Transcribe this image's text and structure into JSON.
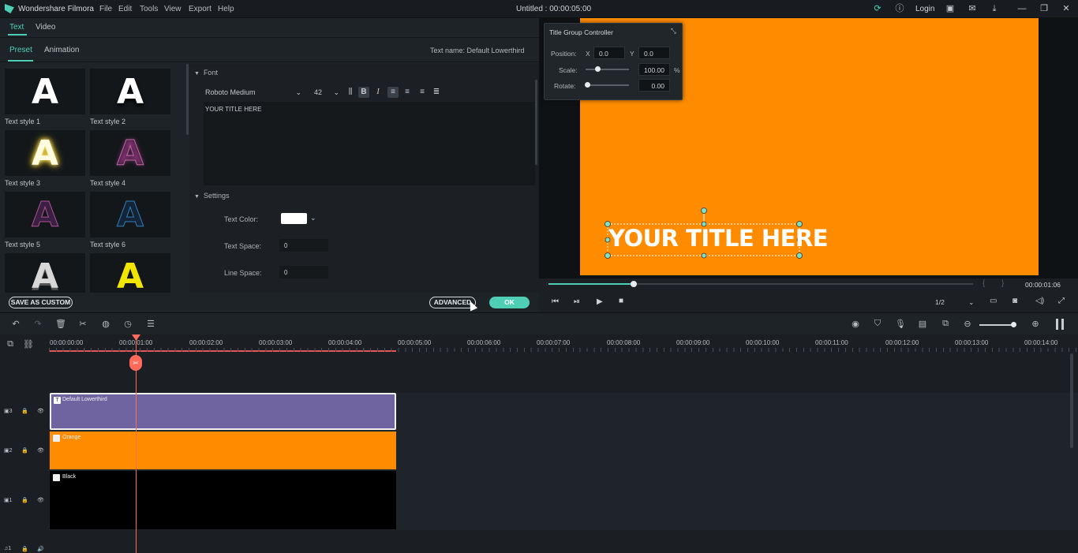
{
  "app": {
    "name": "Wondershare Filmora",
    "doc_title": "Untitled : 00:00:05:00",
    "login": "Login"
  },
  "menu": [
    "File",
    "Edit",
    "Tools",
    "View",
    "Export",
    "Help"
  ],
  "tabs_top": [
    "Text",
    "Video"
  ],
  "tabs_sub": [
    "Preset",
    "Animation"
  ],
  "text_name": "Text name: Default Lowerthird",
  "styles": [
    {
      "label": "Text style 1",
      "glyph": "A"
    },
    {
      "label": "Text style 2",
      "glyph": "A"
    },
    {
      "label": "Text style 3",
      "glyph": "A"
    },
    {
      "label": "Text style 4",
      "glyph": "A"
    },
    {
      "label": "Text style 5",
      "glyph": "A"
    },
    {
      "label": "Text style 6",
      "glyph": "A"
    },
    {
      "label": "",
      "glyph": "A"
    },
    {
      "label": "",
      "glyph": "A"
    }
  ],
  "font": {
    "section": "Font",
    "family": "Roboto Medium",
    "size": "42",
    "text": "YOUR TITLE HERE"
  },
  "settings": {
    "section": "Settings",
    "color_label": "Text Color:",
    "space_label": "Text Space:",
    "space_value": "0",
    "line_label": "Line Space:",
    "line_value": "0",
    "color": "#ffffff"
  },
  "buttons": {
    "save_custom": "SAVE AS CUSTOM",
    "advanced": "ADVANCED",
    "ok": "OK"
  },
  "tgc": {
    "title": "Title Group Controller",
    "position_label": "Position:",
    "x_label": "X",
    "x": "0.0",
    "y_label": "Y",
    "y": "0.0",
    "scale_label": "Scale:",
    "scale": "100.00",
    "pct": "%",
    "rotate_label": "Rotate:",
    "rotate": "0.00"
  },
  "preview": {
    "title_text": "YOUR TITLE HERE",
    "timecode": "00:00:01:06",
    "quality": "1/2",
    "bg_color": "#ff8c00",
    "progress": 0.2
  },
  "ruler": [
    "00:00:00:00",
    "00:00:01:00",
    "00:00:02:00",
    "00:00:03:00",
    "00:00:04:00",
    "00:00:05:00",
    "00:00:06:00",
    "00:00:07:00",
    "00:00:08:00",
    "00:00:09:00",
    "00:00:10:00",
    "00:00:11:00",
    "00:00:12:00",
    "00:00:13:00",
    "00:00:14:00"
  ],
  "tracks": [
    {
      "num": "3",
      "clip": "Default Lowerthird",
      "color": "#7064a0"
    },
    {
      "num": "2",
      "clip": "Orange",
      "color": "#ff8c00"
    },
    {
      "num": "1",
      "clip": "Black",
      "color": "#000000"
    },
    {
      "num": "1",
      "clip": "",
      "color": ""
    }
  ]
}
